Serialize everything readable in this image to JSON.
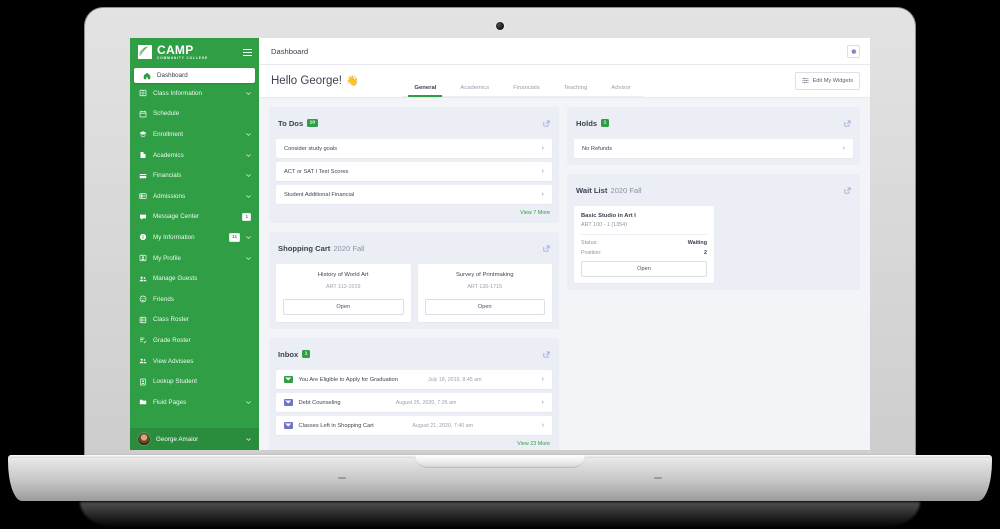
{
  "brand": {
    "name": "CAMP",
    "subtitle": "COMMUNITY COLLEGE",
    "menu_icon": "hamburger-icon"
  },
  "sidebar": {
    "items": [
      {
        "label": "Dashboard",
        "icon": "home-icon",
        "active": true,
        "chevron": false,
        "badge": ""
      },
      {
        "label": "Class Information",
        "icon": "grid-icon",
        "active": false,
        "chevron": true,
        "badge": ""
      },
      {
        "label": "Schedule",
        "icon": "calendar-icon",
        "active": false,
        "chevron": false,
        "badge": ""
      },
      {
        "label": "Enrollment",
        "icon": "cap-icon",
        "active": false,
        "chevron": true,
        "badge": ""
      },
      {
        "label": "Academics",
        "icon": "book-icon",
        "active": false,
        "chevron": true,
        "badge": ""
      },
      {
        "label": "Financials",
        "icon": "card-icon",
        "active": false,
        "chevron": true,
        "badge": ""
      },
      {
        "label": "Admissions",
        "icon": "id-card-icon",
        "active": false,
        "chevron": true,
        "badge": ""
      },
      {
        "label": "Message Center",
        "icon": "chat-icon",
        "active": false,
        "chevron": false,
        "badge": "1"
      },
      {
        "label": "My Information",
        "icon": "info-icon",
        "active": false,
        "chevron": true,
        "badge": "11"
      },
      {
        "label": "My Profile",
        "icon": "person-card-icon",
        "active": false,
        "chevron": true,
        "badge": ""
      },
      {
        "label": "Manage Guests",
        "icon": "people-icon",
        "active": false,
        "chevron": false,
        "badge": ""
      },
      {
        "label": "Friends",
        "icon": "smiley-icon",
        "active": false,
        "chevron": false,
        "badge": ""
      },
      {
        "label": "Class Roster",
        "icon": "roster-icon",
        "active": false,
        "chevron": false,
        "badge": ""
      },
      {
        "label": "Grade Roster",
        "icon": "grade-icon",
        "active": false,
        "chevron": false,
        "badge": ""
      },
      {
        "label": "View Advisees",
        "icon": "people-icon",
        "active": false,
        "chevron": false,
        "badge": ""
      },
      {
        "label": "Lookup Student",
        "icon": "person-box-icon",
        "active": false,
        "chevron": false,
        "badge": ""
      },
      {
        "label": "Fluid Pages",
        "icon": "folder-icon",
        "active": false,
        "chevron": true,
        "badge": ""
      }
    ],
    "user": {
      "name": "George Amaior",
      "avatar": "user-avatar",
      "chevron": true
    }
  },
  "topbar": {
    "title": "Dashboard",
    "settings_icon": "gear-icon"
  },
  "subbar": {
    "greeting": "Hello George!",
    "wave": "👋",
    "tabs": [
      {
        "label": "General",
        "active": true
      },
      {
        "label": "Academics",
        "active": false
      },
      {
        "label": "Financials",
        "active": false
      },
      {
        "label": "Teaching",
        "active": false
      },
      {
        "label": "Advisor",
        "active": false
      }
    ],
    "edit_widgets_label": "Edit My Widgets",
    "edit_widgets_icon": "sliders-icon"
  },
  "todos": {
    "title": "To Dos",
    "count": "10",
    "expand_icon": "external-link-icon",
    "items": [
      {
        "label": "Consider study goals"
      },
      {
        "label": "ACT or SAT I Test Scores"
      },
      {
        "label": "Student Additional Financial"
      }
    ],
    "view_more": "View 7 More"
  },
  "shopping_cart": {
    "title": "Shopping Cart",
    "term": "2020 Fall",
    "expand_icon": "external-link-icon",
    "courses": [
      {
        "name": "History of World Art",
        "code": "ART 112-1019",
        "button": "Open"
      },
      {
        "name": "Survey of Printmaking",
        "code": "ART 130-1715",
        "button": "Open"
      }
    ]
  },
  "inbox": {
    "title": "Inbox",
    "count": "1",
    "expand_icon": "external-link-icon",
    "messages": [
      {
        "subject": "You Are Eligible to Apply for Graduation",
        "date": "July 18, 2019, 8:45 am",
        "unread": true
      },
      {
        "subject": "Debt Counseling",
        "date": "August 25, 2020, 7:26 am",
        "unread": false
      },
      {
        "subject": "Classes Left in Shopping Cart",
        "date": "August 21, 2020, 7:40 am",
        "unread": false
      }
    ],
    "view_more": "View 23 More"
  },
  "holds": {
    "title": "Holds",
    "count": "1",
    "expand_icon": "external-link-icon",
    "items": [
      {
        "label": "No Refunds"
      }
    ]
  },
  "wait_list": {
    "title": "Wait List",
    "term": "2020 Fall",
    "expand_icon": "external-link-icon",
    "entry": {
      "name": "Basic Studio in Art I",
      "code": "ART 100 - 1 (1354)",
      "status_label": "Status:",
      "status_value": "Waiting",
      "position_label": "Position:",
      "position_value": "2",
      "button": "Open"
    }
  },
  "colors": {
    "brand_green": "#2f9e44",
    "page_background": "#f3f4f8",
    "card_background": "#eceef5",
    "accent_purple": "#6f76c8",
    "text_dark": "#3b4150",
    "text_muted": "#9aa1b0"
  }
}
